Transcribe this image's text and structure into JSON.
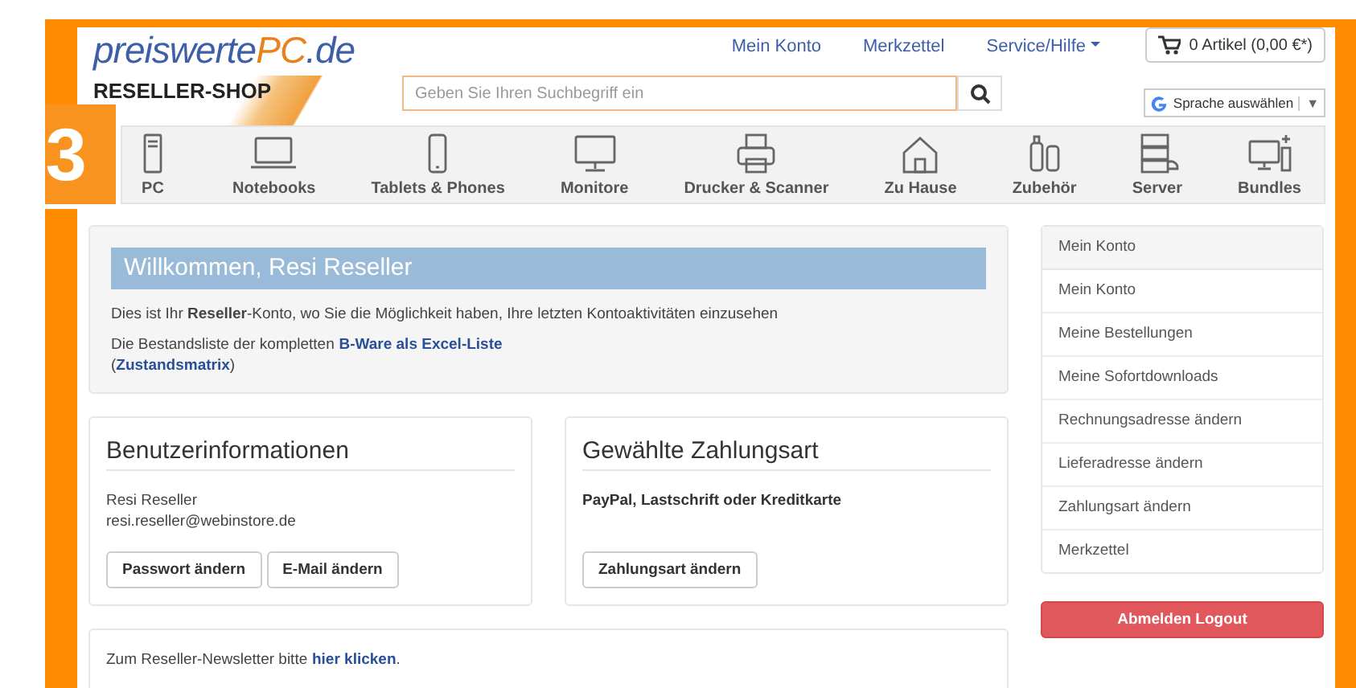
{
  "badge": "3",
  "logo": {
    "parts": [
      {
        "text": "preiswerte",
        "color": "#3d5ea8"
      },
      {
        "text": "PC",
        "color": "#e8821e"
      },
      {
        "text": ".de",
        "color": "#3d5ea8"
      }
    ],
    "subtitle": "RESELLER-SHOP"
  },
  "top_nav": [
    {
      "label": "Mein Konto",
      "dropdown": false
    },
    {
      "label": "Merkzettel",
      "dropdown": false
    },
    {
      "label": "Service/Hilfe",
      "dropdown": true
    }
  ],
  "cart": {
    "label": "0 Artikel (0,00 €*)"
  },
  "search": {
    "placeholder": "Geben Sie Ihren Suchbegriff ein"
  },
  "translate": {
    "label": "Sprache auswählen",
    "caret": "▼"
  },
  "categories": [
    {
      "label": "PC",
      "kind": "tower"
    },
    {
      "label": "Notebooks",
      "kind": "laptop"
    },
    {
      "label": "Tablets & Phones",
      "kind": "phone"
    },
    {
      "label": "Monitore",
      "kind": "monitor"
    },
    {
      "label": "Drucker & Scanner",
      "kind": "printer"
    },
    {
      "label": "Zu Hause",
      "kind": "house"
    },
    {
      "label": "Zubehör",
      "kind": "accessory"
    },
    {
      "label": "Server",
      "kind": "server"
    },
    {
      "label": "Bundles",
      "kind": "bundle"
    }
  ],
  "welcome": {
    "title": "Willkommen, Resi Reseller",
    "text": "Dies ist Ihr **Reseller**-Konto, wo Sie die Möglichkeit haben, Ihre letzten Kontoaktivitäten einzusehen",
    "stock_text": "Die Bestandsliste der kompletten",
    "stock_link": "B-Ware als Excel-Liste",
    "matrix_open": "(",
    "matrix_link": "Zustandsmatrix",
    "matrix_close": ")"
  },
  "user_info": {
    "title": "Benutzerinformationen",
    "name": "Resi Reseller",
    "email": "resi.reseller@webinstore.de",
    "buttons": [
      "Passwort ändern",
      "E-Mail ändern"
    ]
  },
  "payment": {
    "title": "Gewählte Zahlungsart",
    "method": "PayPal, Lastschrift oder Kreditkarte",
    "buttons": [
      "Zahlungsart ändern"
    ]
  },
  "newsletter": {
    "text": "Zum Reseller-Newsletter bitte",
    "link": "hier klicken",
    "end": "."
  },
  "sidebar": {
    "heading": "Mein Konto",
    "items": [
      "Mein Konto",
      "Meine Bestellungen",
      "Meine Sofortdownloads",
      "Rechnungsadresse ändern",
      "Lieferadresse ändern",
      "Zahlungsart ändern",
      "Merkzettel"
    ],
    "logout": "Abmelden Logout"
  }
}
